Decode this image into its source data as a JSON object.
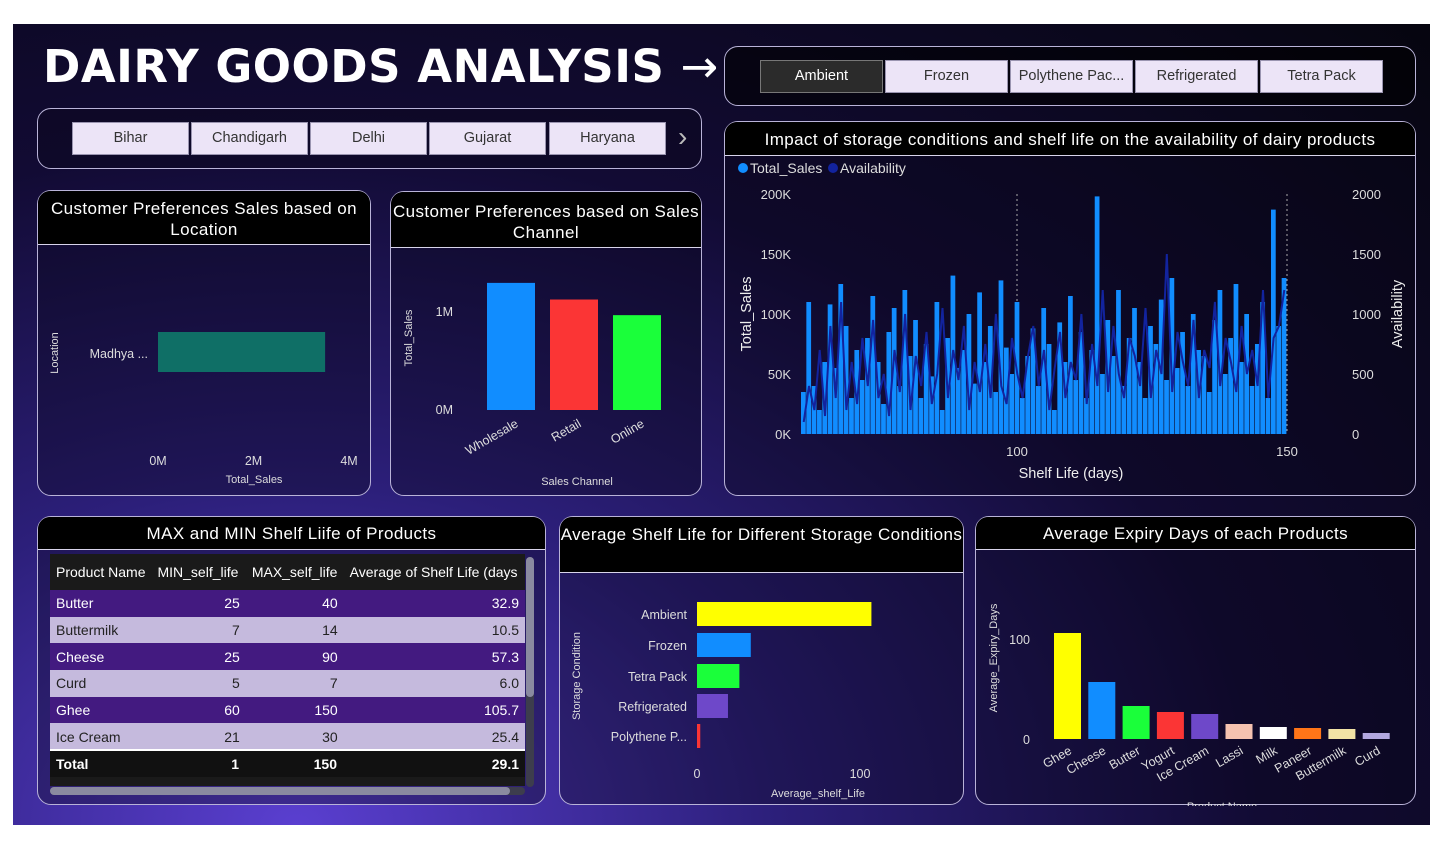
{
  "header": {
    "title": "DAIRY GOODS ANALYSIS",
    "arrow": "→"
  },
  "storage_slicer": {
    "options": [
      "Ambient",
      "Frozen",
      "Polythene Pac...",
      "Refrigerated",
      "Tetra Pack"
    ],
    "selected": "Ambient"
  },
  "location_slicer": {
    "options": [
      "Bihar",
      "Chandigarh",
      "Delhi",
      "Gujarat",
      "Haryana"
    ],
    "next_arrow": "›"
  },
  "colors": {
    "total_sales": "#118dff",
    "availability": "#12239e",
    "teal": "#0f6f66",
    "yellow": "#ffff00",
    "blue": "#118dff",
    "red": "#fb3535",
    "green": "#1aff3a",
    "purple": "#6e48c9"
  },
  "chart_data": [
    {
      "id": "location",
      "type": "bar",
      "title": "Customer Preferences Sales based on Location",
      "orientation": "horizontal",
      "categories": [
        "Madhya ..."
      ],
      "values": [
        3.5
      ],
      "xlabel": "Total_Sales",
      "ylabel": "Location",
      "xlim": [
        0,
        4
      ],
      "ticks": [
        "0M",
        "2M",
        "4M"
      ]
    },
    {
      "id": "channel",
      "type": "bar",
      "title": "Customer Preferences based on Sales Channel",
      "categories": [
        "Wholesale",
        "Retail",
        "Online"
      ],
      "values": [
        1.3,
        1.13,
        0.97
      ],
      "xlabel": "Sales Channel",
      "ylabel": "Total_Sales",
      "ylim": [
        0,
        1.35
      ],
      "ticks": [
        "0M",
        "1M"
      ]
    },
    {
      "id": "storage_impact",
      "type": "bar",
      "title": "Impact of storage conditions and shelf life on the availability of dairy products",
      "legend": [
        "Total_Sales",
        "Availability"
      ],
      "xlabel": "Shelf Life (days)",
      "ylabel": "Total_Sales",
      "y2label": "Availability",
      "xlim": [
        60,
        150
      ],
      "ylim": [
        0,
        200000
      ],
      "y2lim": [
        0,
        2000
      ],
      "x_ticks": [
        "100",
        "150"
      ],
      "y_ticks": [
        "0K",
        "50K",
        "100K",
        "150K",
        "200K"
      ],
      "y2_ticks": [
        "0",
        "500",
        "1000",
        "1500",
        "2000"
      ],
      "x": [
        60,
        61,
        62,
        63,
        64,
        65,
        66,
        67,
        68,
        69,
        70,
        71,
        72,
        73,
        74,
        75,
        76,
        77,
        78,
        79,
        80,
        81,
        82,
        83,
        84,
        85,
        86,
        87,
        88,
        89,
        90,
        91,
        92,
        93,
        94,
        95,
        96,
        97,
        98,
        99,
        100,
        101,
        102,
        103,
        104,
        105,
        106,
        107,
        108,
        109,
        110,
        111,
        112,
        113,
        114,
        115,
        116,
        117,
        118,
        119,
        120,
        121,
        122,
        123,
        124,
        125,
        126,
        127,
        128,
        129,
        130,
        131,
        132,
        133,
        134,
        135,
        136,
        137,
        138,
        139,
        140,
        141,
        142,
        143,
        144,
        145,
        146,
        147,
        148,
        149,
        150
      ],
      "total_sales": [
        35000,
        110000,
        40000,
        20000,
        60000,
        108000,
        55000,
        125000,
        90000,
        30000,
        70000,
        45000,
        80000,
        115000,
        60000,
        25000,
        85000,
        105000,
        40000,
        120000,
        65000,
        95000,
        30000,
        75000,
        48000,
        110000,
        20000,
        80000,
        132000,
        55000,
        70000,
        100000,
        42000,
        118000,
        60000,
        90000,
        35000,
        128000,
        72000,
        50000,
        110000,
        30000,
        65000,
        88000,
        40000,
        105000,
        75000,
        20000,
        93000,
        60000,
        115000,
        45000,
        85000,
        30000,
        70000,
        198000,
        50000,
        95000,
        65000,
        120000,
        40000,
        80000,
        105000,
        60000,
        30000,
        90000,
        75000,
        112000,
        45000,
        130000,
        55000,
        85000,
        40000,
        100000,
        70000,
        65000,
        35000,
        95000,
        120000,
        50000,
        80000,
        125000,
        60000,
        100000,
        40000,
        75000,
        110000,
        30000,
        187000,
        90000,
        130000
      ],
      "availability": [
        100,
        400,
        200,
        700,
        150,
        900,
        300,
        1100,
        200,
        600,
        250,
        800,
        400,
        950,
        300,
        500,
        150,
        700,
        350,
        1000,
        200,
        650,
        400,
        850,
        250,
        500,
        1050,
        300,
        700,
        450,
        900,
        200,
        600,
        350,
        750,
        300,
        1000,
        400,
        250,
        800,
        500,
        300,
        650,
        900,
        400,
        700,
        200,
        550,
        850,
        300,
        600,
        450,
        1000,
        250,
        750,
        400,
        1200,
        350,
        900,
        500,
        300,
        800,
        650,
        400,
        1050,
        300,
        700,
        500,
        1500,
        350,
        850,
        600,
        400,
        950,
        300,
        700,
        550,
        1100,
        400,
        800,
        600,
        350,
        900,
        500,
        700,
        400,
        1200,
        300,
        800,
        900,
        1200
      ]
    },
    {
      "id": "avg_shelf_storage",
      "type": "bar",
      "title": "Average Shelf Life for Different Storage Conditions",
      "orientation": "horizontal",
      "categories": [
        "Ambient",
        "Frozen",
        "Tetra Pack",
        "Refrigerated",
        "Polythene P..."
      ],
      "values": [
        107,
        33,
        26,
        19,
        2
      ],
      "xlabel": "Average_shelf_Life",
      "ylabel": "Storage Condition",
      "xlim": [
        0,
        110
      ],
      "ticks": [
        "0",
        "100"
      ]
    },
    {
      "id": "expiry",
      "type": "bar",
      "title": "Average Expiry Days of each Products",
      "categories": [
        "Ghee",
        "Cheese",
        "Butter",
        "Yogurt",
        "Ice Cream",
        "Lassi",
        "Milk",
        "Paneer",
        "Buttermilk",
        "Curd"
      ],
      "values": [
        106,
        57,
        33,
        27,
        25,
        15,
        12,
        11,
        10,
        6
      ],
      "xlabel": "Product Name",
      "ylabel": "Average_Expiry_Days",
      "ylim": [
        0,
        110
      ],
      "ticks": [
        "0",
        "100"
      ]
    },
    {
      "id": "shelf_table",
      "type": "table",
      "title": "MAX and MIN Shelf Liife of Products",
      "columns": [
        "Product Name",
        "MIN_self_life",
        "MAX_self_life",
        "Average of Shelf Life (days"
      ],
      "rows": [
        [
          "Butter",
          "25",
          "40",
          "32.9"
        ],
        [
          "Buttermilk",
          "7",
          "14",
          "10.5"
        ],
        [
          "Cheese",
          "25",
          "90",
          "57.3"
        ],
        [
          "Curd",
          "5",
          "7",
          "6.0"
        ],
        [
          "Ghee",
          "60",
          "150",
          "105.7"
        ],
        [
          "Ice Cream",
          "21",
          "30",
          "25.4"
        ]
      ],
      "total": [
        "Total",
        "1",
        "150",
        "29.1"
      ]
    }
  ]
}
